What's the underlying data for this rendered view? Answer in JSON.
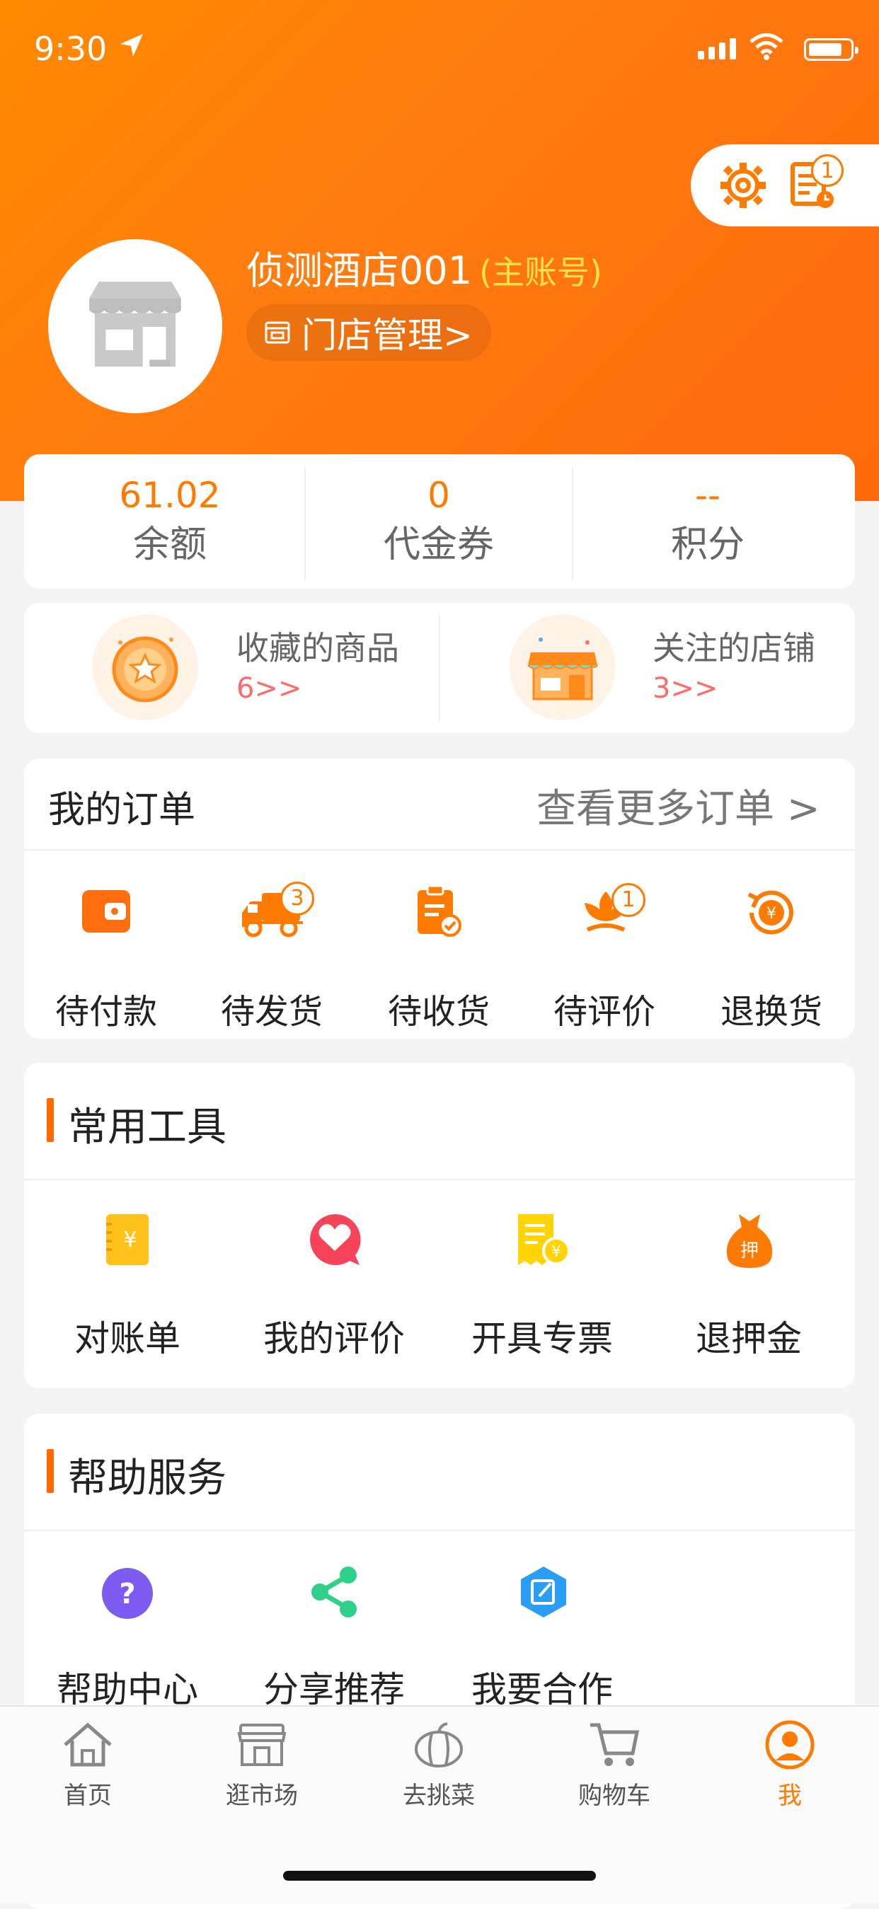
{
  "status_bar": {
    "time": "9:30"
  },
  "header": {
    "store_name": "侦测酒店001",
    "account_type": "(主账号)",
    "store_manage_label": "门店管理>",
    "orders_badge": "1"
  },
  "stats": [
    {
      "value": "61.02",
      "label": "余额"
    },
    {
      "value": "0",
      "label": "代金券"
    },
    {
      "value": "--",
      "label": "积分"
    }
  ],
  "favorites": [
    {
      "title": "收藏的商品",
      "count": "6>>"
    },
    {
      "title": "关注的店铺",
      "count": "3>>"
    }
  ],
  "orders": {
    "title": "我的订单",
    "more": "查看更多订单 >",
    "items": [
      {
        "label": "待付款",
        "icon": "wallet-icon",
        "badge": ""
      },
      {
        "label": "待发货",
        "icon": "truck-icon",
        "badge": "3"
      },
      {
        "label": "待收货",
        "icon": "clipboard-check-icon",
        "badge": ""
      },
      {
        "label": "待评价",
        "icon": "flower-icon",
        "badge": "1"
      },
      {
        "label": "退换货",
        "icon": "refund-icon",
        "badge": ""
      }
    ]
  },
  "tools": {
    "title": "常用工具",
    "items": [
      {
        "label": "对账单",
        "icon": "bill-icon"
      },
      {
        "label": "我的评价",
        "icon": "heart-chat-icon"
      },
      {
        "label": "开具专票",
        "icon": "invoice-icon"
      },
      {
        "label": "退押金",
        "icon": "deposit-bag-icon"
      }
    ]
  },
  "help": {
    "title": "帮助服务",
    "items": [
      {
        "label": "帮助中心",
        "icon": "question-icon"
      },
      {
        "label": "分享推荐",
        "icon": "share-icon"
      },
      {
        "label": "我要合作",
        "icon": "edit-hexagon-icon"
      }
    ]
  },
  "tabbar": [
    {
      "label": "首页",
      "icon": "home-icon"
    },
    {
      "label": "逛市场",
      "icon": "market-icon"
    },
    {
      "label": "去挑菜",
      "icon": "vegetable-icon"
    },
    {
      "label": "购物车",
      "icon": "cart-icon"
    },
    {
      "label": "我",
      "icon": "profile-icon",
      "active": true
    }
  ],
  "colors": {
    "accent": "#ff7a00",
    "badge_yellow": "#ffe24d",
    "count_pink": "#ff6b6b"
  }
}
